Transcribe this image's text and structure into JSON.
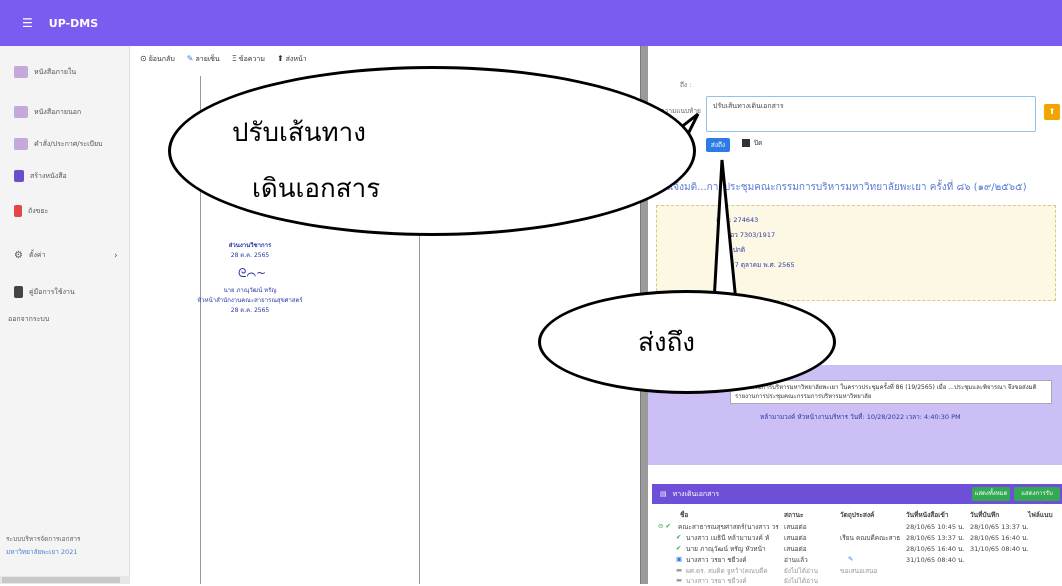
{
  "app": {
    "title": "UP-DMS"
  },
  "sidebar": {
    "items": [
      {
        "label": "หนังสือภายใน",
        "icon": "inbox-icon"
      },
      {
        "label": "หนังสือภายนอก",
        "icon": "outbox-icon"
      },
      {
        "label": "คำสั่ง/ประกาศ/ระเบียบ",
        "icon": "order-icon"
      },
      {
        "label": "สร้างหนังสือ",
        "icon": "create-doc-icon"
      },
      {
        "label": "ถังขยะ",
        "icon": "trash-icon"
      },
      {
        "label": "ตั้งค่า",
        "icon": "gear-icon"
      },
      {
        "label": "คู่มือการใช้งาน",
        "icon": "manual-icon"
      },
      {
        "label": "ออกจากระบบ",
        "icon": ""
      }
    ],
    "footer_line1": "ระบบบริหารจัดการเอกสาร",
    "footer_line2": "มหาวิทยาลัยพะเยา 2021"
  },
  "toolbar": {
    "back": "ย้อนกลับ",
    "comments": "ลายเซ็น",
    "message": "ข้อความ",
    "sendup": "ส่งหน้า"
  },
  "doc": {
    "date1": "28 ต.ค. 2565",
    "signer": "นาย ภาณุวัฒน์ หรัญ",
    "position": "หัวหน้าสำนักงานคณะสาธารณสุขศาสตร์",
    "date2": "28 ต.ค. 2565",
    "org": "ส่วนงานวิชาการ"
  },
  "form": {
    "to_label": "ถึง :",
    "msg_label": "ข้อความแนบท้าย",
    "msg_value": "ปรับเส้นทางเดินเอกสาร",
    "send": "ส่งถึง",
    "close": "ปิด"
  },
  "doc_info": {
    "title": "ขอแจ้งมติ...การประชุมคณะกรรมการบริหารมหาวิทยาลัยพะเยา ครั้งที่ ๘๖ (๑๙/๒๕๖๕)",
    "row1": "สาร : 274643",
    "row2": "สือ : อว 7303/1917",
    "row3": "จริง : ปกติ",
    "row4": "วันที่ 27 ตุลาคม พ.ศ. 2565"
  },
  "message_box": {
    "text": "คณะกรรมการบริหารมหาวิทยาลัยพะเยา ในคราวประชุมครั้งที่ 86 (19/2565) เมื่อ ...ประชุมและพิจารณา จึงขอส่งมติรายงานการประชุมคณะกรรมการบริหารมหาวิทยาลัย",
    "sender": "หล้ามามวงค์ หัวหน้างานบริหาร  วันที่: 10/28/2022  เวลา: 4:40:30 PM"
  },
  "route_panel": {
    "title": "ทางเดินเอกสาร",
    "btn1": "แสดงทั้งหมด",
    "btn2": "แสดงการรับหนังสือ",
    "headers": [
      "ชื่อ",
      "สถานะ",
      "วัตถุประสงค์",
      "วันที่หนังสือเข้า",
      "วันที่บันทึก",
      "ไฟล์แนบ"
    ],
    "rows": [
      {
        "name": "คณะสาธารณสุขศาสตร์(นางสาว วร",
        "status": "เสนอต่อ",
        "purpose": "",
        "in": "28/10/65 10:45 น.",
        "saved": "28/10/65 13:37 น."
      },
      {
        "name": "นางสาว เมธินี หล้ามามวงค์ หั",
        "status": "เสนอต่อ",
        "purpose": "เรียน คณบดีคณะสาธ",
        "in": "28/10/65 13:37 น.",
        "saved": "28/10/65 16:40 น."
      },
      {
        "name": "นาย ภาณุวัฒน์ หรัญ หัวหน้า",
        "status": "เสนอต่อ",
        "purpose": "",
        "in": "28/10/65 16:40 น.",
        "saved": "31/10/65 08:40 น."
      },
      {
        "name": "นางสาว วรยา ชยีวงค์",
        "status": "อ่านแล้ว",
        "purpose": "",
        "in": "31/10/65 08:40 น.",
        "saved": ""
      },
      {
        "name": "ผศ.ดร. สมคิด จูหว้า(คณบดีค",
        "status": "ยังไม่ได้อ่าน",
        "purpose": "ขอเสนอเสนอ",
        "in": "",
        "saved": ""
      },
      {
        "name": "นางสาว วรยา ชยีวงค์",
        "status": "ยังไม่ได้อ่าน",
        "purpose": "",
        "in": "",
        "saved": ""
      }
    ]
  },
  "callouts": {
    "bubble1_line1": "ปรับเส้นทาง",
    "bubble1_line2": "เดินเอกสาร",
    "bubble2": "ส่งถึง"
  },
  "colors": {
    "topbar": "#7b5cf0",
    "panel_head": "#6e4fd8",
    "send_button": "#2d7be5",
    "purple_box": "#cbbff5"
  }
}
